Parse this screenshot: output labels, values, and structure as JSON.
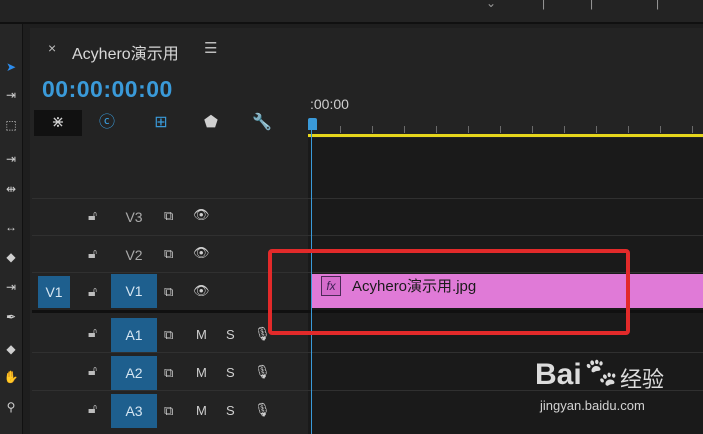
{
  "sequence_tab": {
    "close_glyph": "×",
    "title": "Acyhero演示用",
    "menu_glyph": "☰"
  },
  "timecode": "00:00:00:00",
  "ruler": {
    "start_label": ":00:00"
  },
  "toolbar_icons": [
    "selection-arrow-icon",
    "track-select-icon",
    "marquee-icon",
    "ripple-edit-icon",
    "rolling-edit-icon",
    "rate-stretch-icon",
    "razor-icon",
    "slip-icon",
    "pen-icon",
    "hand-icon",
    "zoom-icon"
  ],
  "timeline_controls": [
    "snap-icon",
    "linked-selection-icon",
    "add-marker-icon",
    "marker-icon",
    "wrench-icon"
  ],
  "tracks": {
    "video": [
      {
        "name": "V3",
        "source": "",
        "targeted": false
      },
      {
        "name": "V2",
        "source": "",
        "targeted": false
      },
      {
        "name": "V1",
        "source": "V1",
        "targeted": true
      }
    ],
    "audio": [
      {
        "name": "A1",
        "mute": "M",
        "solo": "S"
      },
      {
        "name": "A2",
        "mute": "M",
        "solo": "S"
      },
      {
        "name": "A3",
        "mute": "M",
        "solo": "S"
      }
    ]
  },
  "clip": {
    "fx_badge": "fx",
    "name": "Acyhero演示用.jpg",
    "color": "#e07ad7"
  },
  "watermark": {
    "brand": "Bai",
    "brand2": "经验",
    "url": "jingyan.baidu.com"
  },
  "colors": {
    "accent": "#3a9ad9",
    "work_area": "#e6d61c",
    "highlight": "#e22a2a"
  }
}
